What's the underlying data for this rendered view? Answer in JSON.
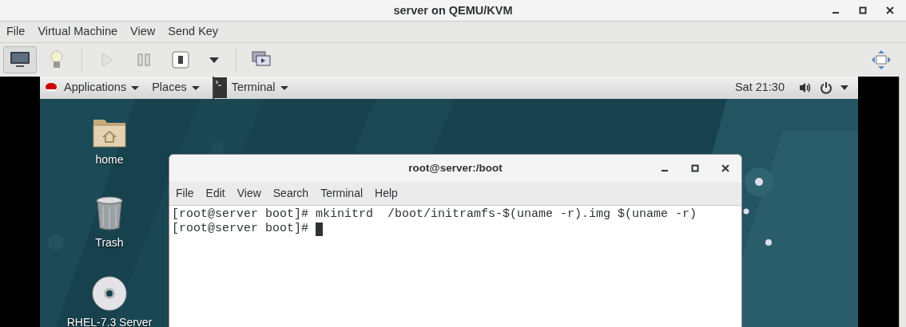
{
  "window": {
    "title": "server on QEMU/KVM"
  },
  "menu": [
    "File",
    "Virtual Machine",
    "View",
    "Send Key"
  ],
  "view_buttons": [
    {
      "kind": "monitor",
      "selected": true
    },
    {
      "kind": "bulb",
      "selected": false
    }
  ],
  "action_buttons": [
    {
      "kind": "play",
      "disabled": true
    },
    {
      "kind": "pause",
      "disabled": false
    },
    {
      "kind": "power",
      "disabled": false
    },
    {
      "kind": "dropdown",
      "disabled": false
    }
  ],
  "guest_panel": {
    "menus": [
      "Applications",
      "Places"
    ],
    "task": "Terminal",
    "clock": "Sat 21:30"
  },
  "desktop_icons": [
    {
      "kind": "folder",
      "label": "home"
    },
    {
      "kind": "trash",
      "label": "Trash"
    },
    {
      "kind": "disc",
      "label": "RHEL-7.3 Server"
    }
  ],
  "terminal": {
    "title": "root@server:/boot",
    "menu": [
      "File",
      "Edit",
      "View",
      "Search",
      "Terminal",
      "Help"
    ],
    "lines": [
      "[root@server boot]# mkinitrd  /boot/initramfs-$(uname -r).img $(uname -r)",
      "[root@server boot]# "
    ],
    "cursor": true
  }
}
